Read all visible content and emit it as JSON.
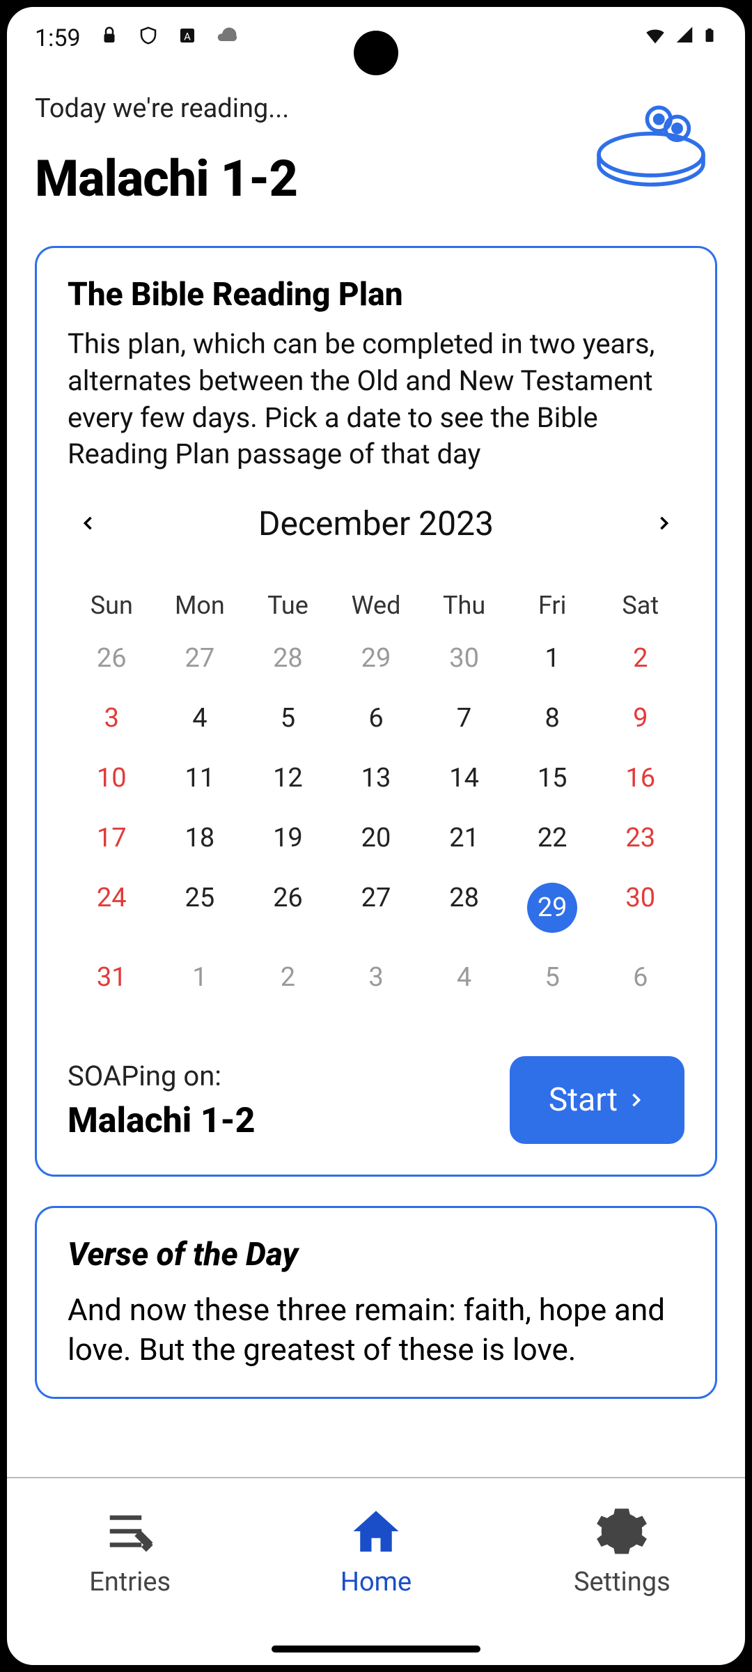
{
  "status": {
    "time": "1:59"
  },
  "header": {
    "greeting": "Today we're reading...",
    "passage": "Malachi 1-2"
  },
  "plan": {
    "title": "The Bible Reading Plan",
    "description": "This plan, which can be completed in two years, alternates between the Old and New Testament every few days. Pick a date to see the Bible Reading Plan passage of that day",
    "month_label": "December 2023",
    "weekdays": [
      "Sun",
      "Mon",
      "Tue",
      "Wed",
      "Thu",
      "Fri",
      "Sat"
    ],
    "weeks": [
      [
        {
          "d": "26",
          "muted": true
        },
        {
          "d": "27",
          "muted": true
        },
        {
          "d": "28",
          "muted": true
        },
        {
          "d": "29",
          "muted": true
        },
        {
          "d": "30",
          "muted": true
        },
        {
          "d": "1"
        },
        {
          "d": "2",
          "weekend": true
        }
      ],
      [
        {
          "d": "3",
          "weekend": true
        },
        {
          "d": "4"
        },
        {
          "d": "5"
        },
        {
          "d": "6"
        },
        {
          "d": "7"
        },
        {
          "d": "8"
        },
        {
          "d": "9",
          "weekend": true
        }
      ],
      [
        {
          "d": "10",
          "weekend": true
        },
        {
          "d": "11"
        },
        {
          "d": "12"
        },
        {
          "d": "13"
        },
        {
          "d": "14"
        },
        {
          "d": "15"
        },
        {
          "d": "16",
          "weekend": true
        }
      ],
      [
        {
          "d": "17",
          "weekend": true
        },
        {
          "d": "18"
        },
        {
          "d": "19"
        },
        {
          "d": "20"
        },
        {
          "d": "21"
        },
        {
          "d": "22"
        },
        {
          "d": "23",
          "weekend": true
        }
      ],
      [
        {
          "d": "24",
          "weekend": true
        },
        {
          "d": "25"
        },
        {
          "d": "26"
        },
        {
          "d": "27"
        },
        {
          "d": "28"
        },
        {
          "d": "29",
          "selected": true
        },
        {
          "d": "30",
          "weekend": true
        }
      ],
      [
        {
          "d": "31",
          "weekend": true
        },
        {
          "d": "1",
          "muted": true
        },
        {
          "d": "2",
          "muted": true
        },
        {
          "d": "3",
          "muted": true
        },
        {
          "d": "4",
          "muted": true
        },
        {
          "d": "5",
          "muted": true
        },
        {
          "d": "6",
          "muted": true
        }
      ]
    ],
    "soap_label": "SOAPing on:",
    "soap_passage": "Malachi 1-2",
    "start_label": "Start"
  },
  "votd": {
    "title": "Verse of the Day",
    "body": "And now these three remain: faith, hope and love. But the greatest of these is love."
  },
  "nav": {
    "entries": "Entries",
    "home": "Home",
    "settings": "Settings"
  }
}
